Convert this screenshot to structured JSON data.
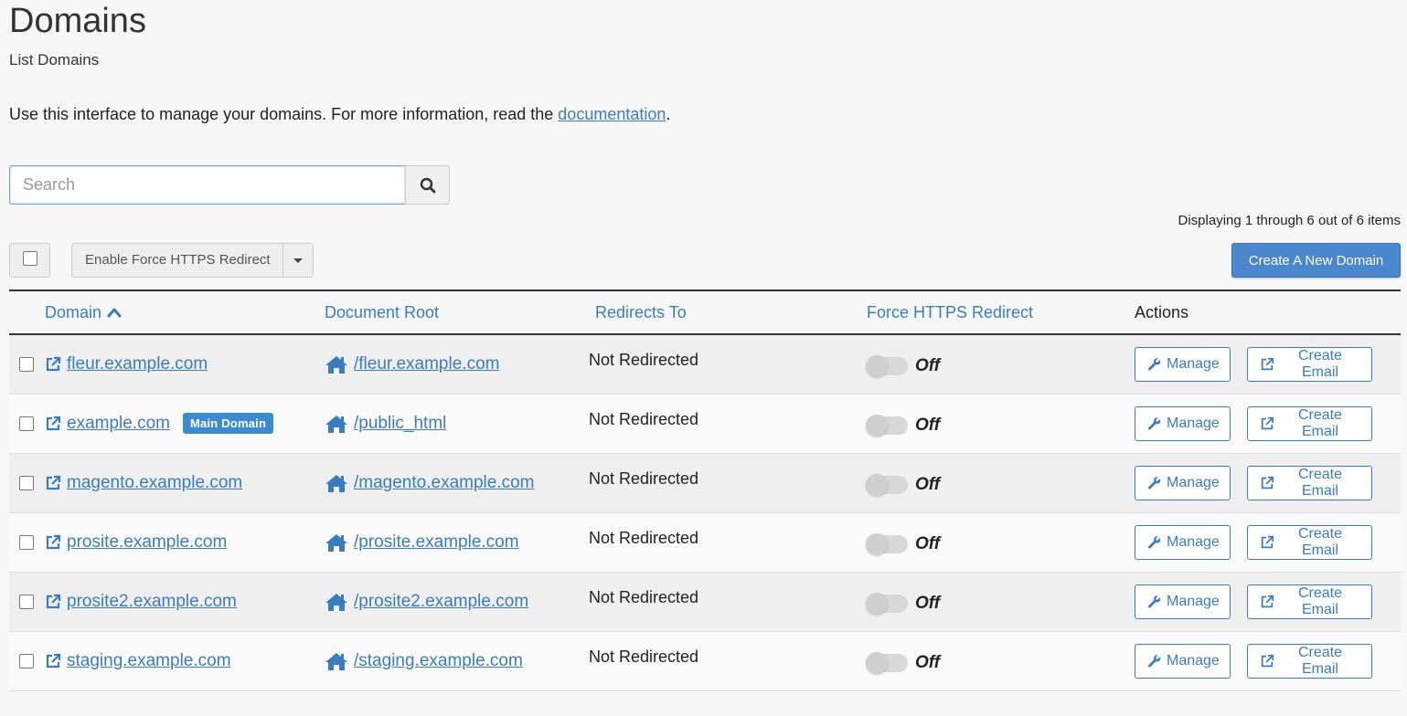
{
  "page": {
    "title": "Domains",
    "subtitle": "List Domains",
    "intro_text": "Use this interface to manage your domains. For more information, read the ",
    "intro_link": "documentation",
    "intro_end": "."
  },
  "search": {
    "placeholder": "Search",
    "value": ""
  },
  "toolbar": {
    "display_count": "Displaying 1 through 6 out of 6 items",
    "bulk_action_label": "Enable Force HTTPS Redirect",
    "create_button": "Create A New Domain"
  },
  "table": {
    "headers": {
      "domain": "Domain",
      "document_root": "Document Root",
      "redirects_to": "Redirects To",
      "force_https": "Force HTTPS Redirect",
      "actions": "Actions"
    },
    "sort_icon": "chevron-up-icon",
    "action_labels": {
      "manage": "Manage",
      "create_email": "Create Email"
    },
    "rows": [
      {
        "domain": "fleur.example.com",
        "badge": "",
        "doc_root": "/fleur.example.com",
        "redirects": "Not Redirected",
        "https": "Off"
      },
      {
        "domain": "example.com",
        "badge": "Main Domain",
        "doc_root": "/public_html",
        "redirects": "Not Redirected",
        "https": "Off"
      },
      {
        "domain": "magento.example.com",
        "badge": "",
        "doc_root": "/magento.example.com",
        "redirects": "Not Redirected",
        "https": "Off"
      },
      {
        "domain": "prosite.example.com",
        "badge": "",
        "doc_root": "/prosite.example.com",
        "redirects": "Not Redirected",
        "https": "Off"
      },
      {
        "domain": "prosite2.example.com",
        "badge": "",
        "doc_root": "/prosite2.example.com",
        "redirects": "Not Redirected",
        "https": "Off"
      },
      {
        "domain": "staging.example.com",
        "badge": "",
        "doc_root": "/staging.example.com",
        "redirects": "Not Redirected",
        "https": "Off"
      }
    ]
  },
  "colors": {
    "link": "#3b7cc1",
    "primary_button": "#4a87cc",
    "badge": "#3b8bce"
  }
}
